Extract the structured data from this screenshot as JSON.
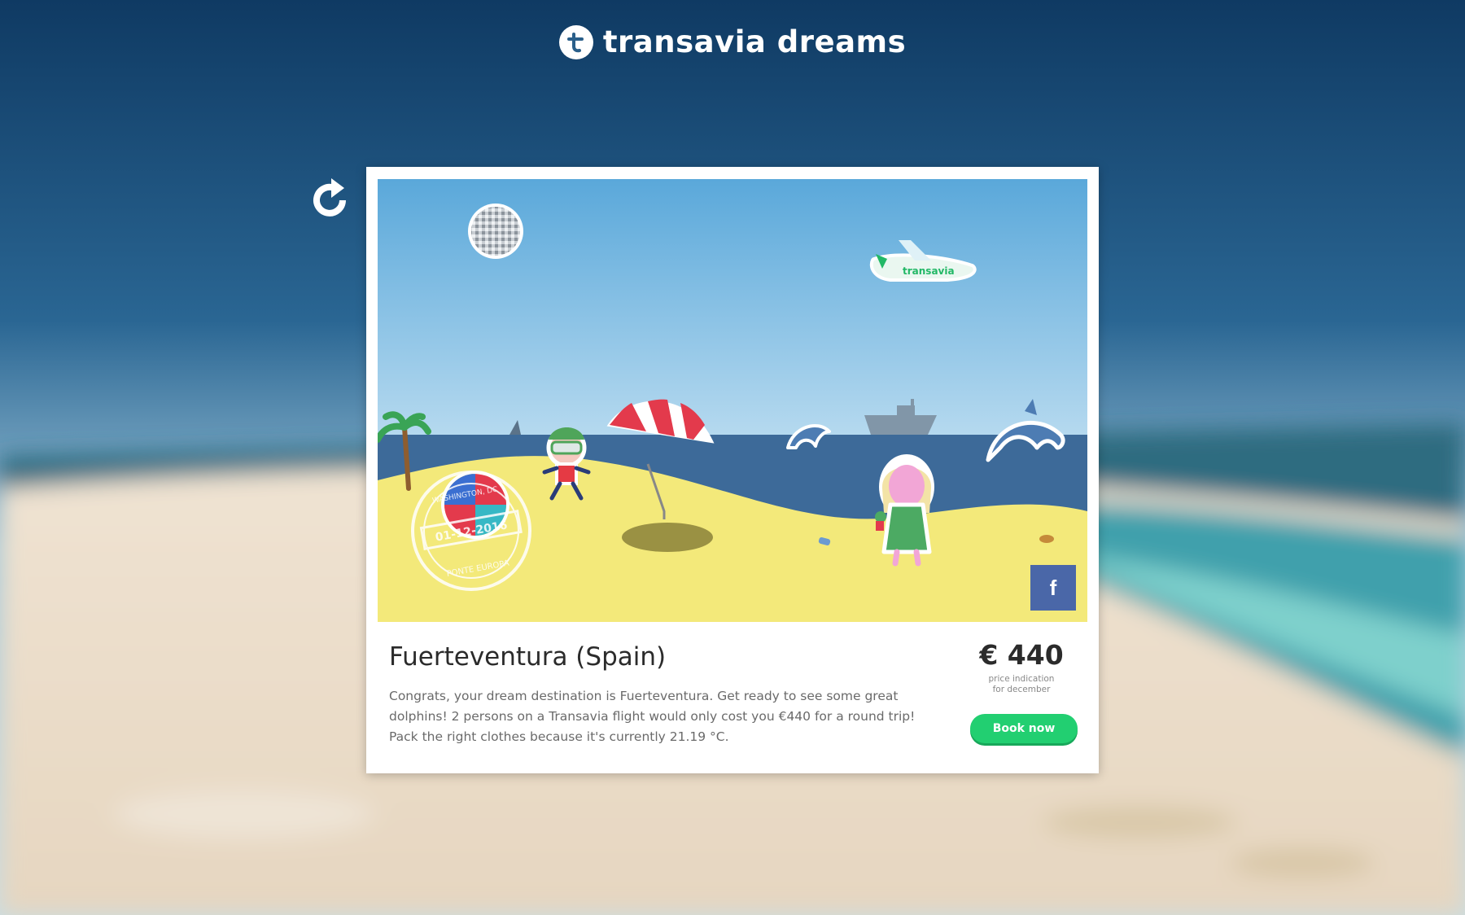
{
  "brand": {
    "name": "transavia dreams"
  },
  "destination": {
    "title": "Fuerteventura (Spain)",
    "description": "Congrats, your dream destination is Fuerteventura. Get ready to see some great dolphins! 2 persons on a Transavia flight would only cost you €440 for a round trip! Pack the right clothes because it's currently 21.19 °C."
  },
  "price": {
    "amount": "€ 440",
    "note_line1": "price indication",
    "note_line2": "for december"
  },
  "actions": {
    "book_label": "Book now",
    "facebook_label": "f",
    "reload_icon": "reload-icon"
  },
  "scene": {
    "plane_label": "transavia",
    "stamp_top": "WASHINGTON, DC",
    "stamp_date": "01-12-2016",
    "stamp_bottom": "PONTE EUROPA"
  },
  "colors": {
    "book_button": "#22cf71",
    "facebook": "#4a67a8",
    "sky": "#7fb6e0",
    "sea": "#3d6a99",
    "sand": "#f3e97a"
  }
}
